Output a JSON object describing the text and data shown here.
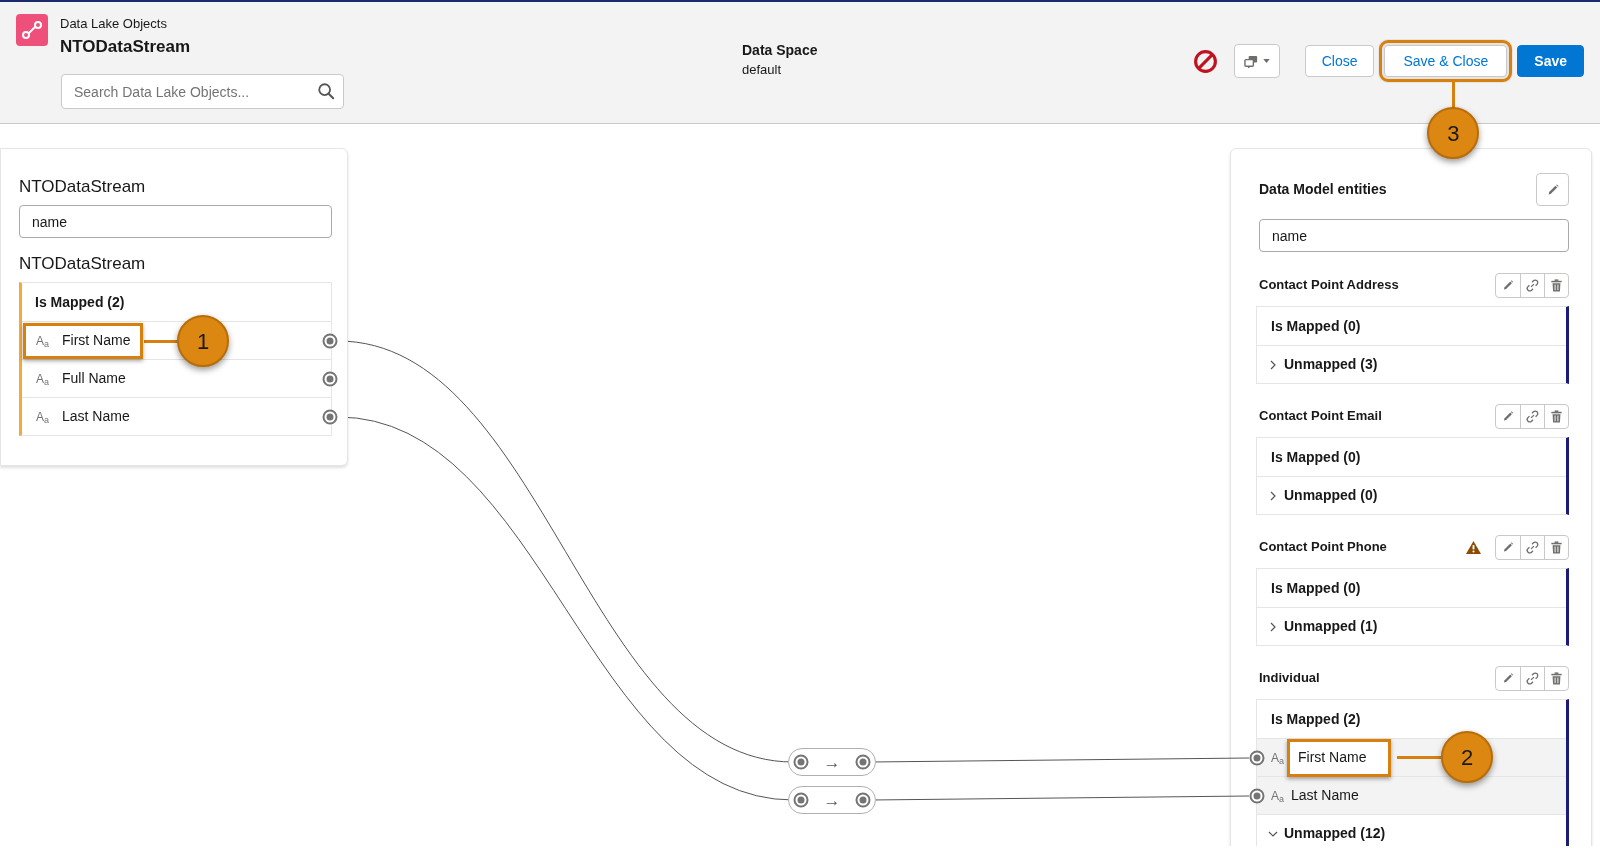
{
  "header": {
    "object_type": "Data Lake Objects",
    "title": "NTODataStream",
    "search": {
      "placeholder": "Search Data Lake Objects..."
    },
    "data_space": {
      "label": "Data Space",
      "value": "default"
    },
    "buttons": [
      {
        "label": "Close",
        "kind": "neutral"
      },
      {
        "label": "Save & Close",
        "kind": "neutral",
        "callout": "3"
      },
      {
        "label": "Save",
        "kind": "brand"
      }
    ]
  },
  "source_panel": {
    "title": "NTODataStream",
    "filter": {
      "value": "name"
    },
    "object_title": "NTODataStream",
    "group": {
      "label": "Is Mapped (2)",
      "fields": [
        {
          "type_icon": "A$_{a}$",
          "label": "First Name",
          "callout": "1",
          "mapping": {
            "arrow": "→"
          }
        },
        {
          "type_icon": "A$_{a}$",
          "label": "Full Name"
        },
        {
          "type_icon": "A$_{a}$",
          "label": "Last Name",
          "mapping": {
            "arrow": "→"
          }
        }
      ]
    }
  },
  "target_panel": {
    "title": "Data Model entities",
    "filter": {
      "value": "name"
    },
    "entities": [
      {
        "name": "Contact Point Address",
        "warning": false,
        "groups": [
          {
            "label": "Is Mapped (0)",
            "kind": "header"
          },
          {
            "label": "Unmapped (3)",
            "kind": "toggle",
            "expanded": false
          }
        ]
      },
      {
        "name": "Contact Point Email",
        "warning": false,
        "groups": [
          {
            "label": "Is Mapped (0)",
            "kind": "header"
          },
          {
            "label": "Unmapped (0)",
            "kind": "toggle",
            "expanded": false
          }
        ]
      },
      {
        "name": "Contact Point Phone",
        "warning": true,
        "groups": [
          {
            "label": "Is Mapped (0)",
            "kind": "header"
          },
          {
            "label": "Unmapped (1)",
            "kind": "toggle",
            "expanded": false
          }
        ]
      },
      {
        "name": "Individual",
        "warning": false,
        "groups": [
          {
            "label": "Is Mapped (2)",
            "kind": "header",
            "fields": [
              {
                "type_icon": "A$_{a}$",
                "label": "First Name",
                "callout": "2"
              },
              {
                "type_icon": "A$_{a}$",
                "label": "Last Name"
              }
            ]
          },
          {
            "label": "Unmapped (12)",
            "kind": "toggle",
            "expanded": true
          }
        ]
      }
    ]
  }
}
